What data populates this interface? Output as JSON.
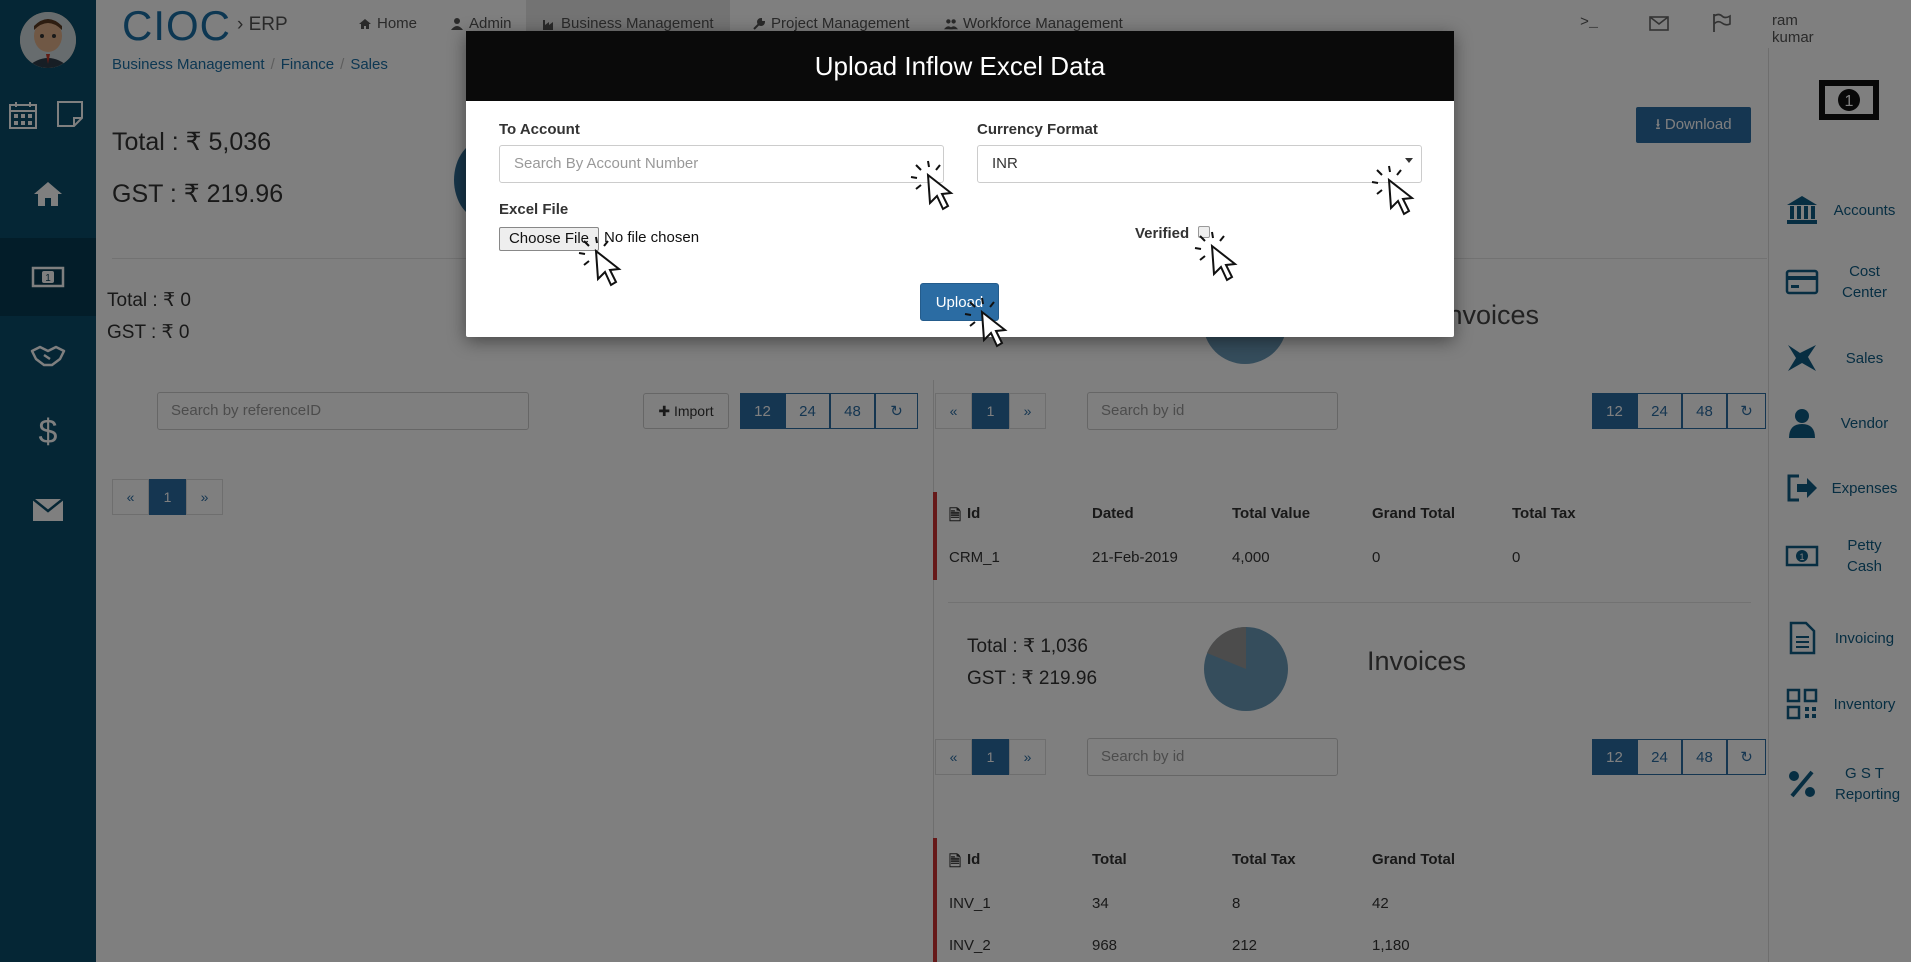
{
  "nav": {
    "brand": "CIOC",
    "brand_sub": "ERP",
    "items": [
      {
        "label": "Home",
        "icon": "home-icon"
      },
      {
        "label": "Admin",
        "icon": "user-icon"
      },
      {
        "label": "Business Management",
        "icon": "industry-icon"
      },
      {
        "label": "Project Management",
        "icon": "wrench-icon"
      },
      {
        "label": "Workforce Management",
        "icon": "users-icon"
      }
    ],
    "user": "ram kumar"
  },
  "breadcrumb": [
    "Business Management",
    "Finance",
    "Sales"
  ],
  "summary": {
    "total": "Total : ₹ 5,036",
    "gst": "GST : ₹ 219.96"
  },
  "left_panel": {
    "total": "Total : ₹ 0",
    "gst": "GST : ₹ 0",
    "search_placeholder": "Search by referenceID",
    "import_label": "Import",
    "page_sizes": [
      "12",
      "24",
      "48"
    ],
    "pager": [
      "«",
      "1",
      "»"
    ]
  },
  "crm_section": {
    "title": "Invoices",
    "search_placeholder": "Search by id",
    "pager": [
      "«",
      "1",
      "»"
    ],
    "page_sizes": [
      "12",
      "24",
      "48"
    ],
    "headers": [
      "Id",
      "Dated",
      "Total Value",
      "Grand Total",
      "Total Tax"
    ],
    "rows": [
      [
        "CRM_1",
        "21-Feb-2019",
        "4,000",
        "0",
        "0"
      ]
    ]
  },
  "invoice_section": {
    "total": "Total : ₹ 1,036",
    "gst": "GST : ₹ 219.96",
    "title": "Invoices",
    "search_placeholder": "Search by id",
    "pager": [
      "«",
      "1",
      "»"
    ],
    "page_sizes": [
      "12",
      "24",
      "48"
    ],
    "headers": [
      "Id",
      "Total",
      "Total Tax",
      "Grand Total"
    ],
    "rows": [
      [
        "INV_1",
        "34",
        "8",
        "42"
      ],
      [
        "INV_2",
        "968",
        "212",
        "1,180"
      ]
    ]
  },
  "download_label": "Download",
  "right_sidebar": [
    {
      "label": "Accounts",
      "icon": "bank-icon"
    },
    {
      "label": "Cost Center",
      "icon": "credit-card-icon"
    },
    {
      "label": "Sales",
      "icon": "sales-icon"
    },
    {
      "label": "Vendor",
      "icon": "person-icon"
    },
    {
      "label": "Expenses",
      "icon": "sign-out-icon"
    },
    {
      "label": "Petty Cash",
      "icon": "money-icon"
    },
    {
      "label": "Invoicing",
      "icon": "document-icon"
    },
    {
      "label": "Inventory",
      "icon": "qrcode-icon"
    },
    {
      "label": "G S T Reporting",
      "icon": "percent-icon"
    }
  ],
  "modal": {
    "title": "Upload Inflow Excel Data",
    "to_account_label": "To Account",
    "to_account_placeholder": "Search By Account Number",
    "currency_label": "Currency Format",
    "currency_value": "INR",
    "excel_label": "Excel File",
    "choose_file": "Choose File",
    "no_file": "No file chosen",
    "verified_label": "Verified",
    "upload_label": "Upload"
  },
  "colors": {
    "sidebar": "#0b4d6b",
    "primary": "#2b6ca3",
    "row_accent": "#cc3333",
    "modal_header": "#0a0a0a"
  }
}
